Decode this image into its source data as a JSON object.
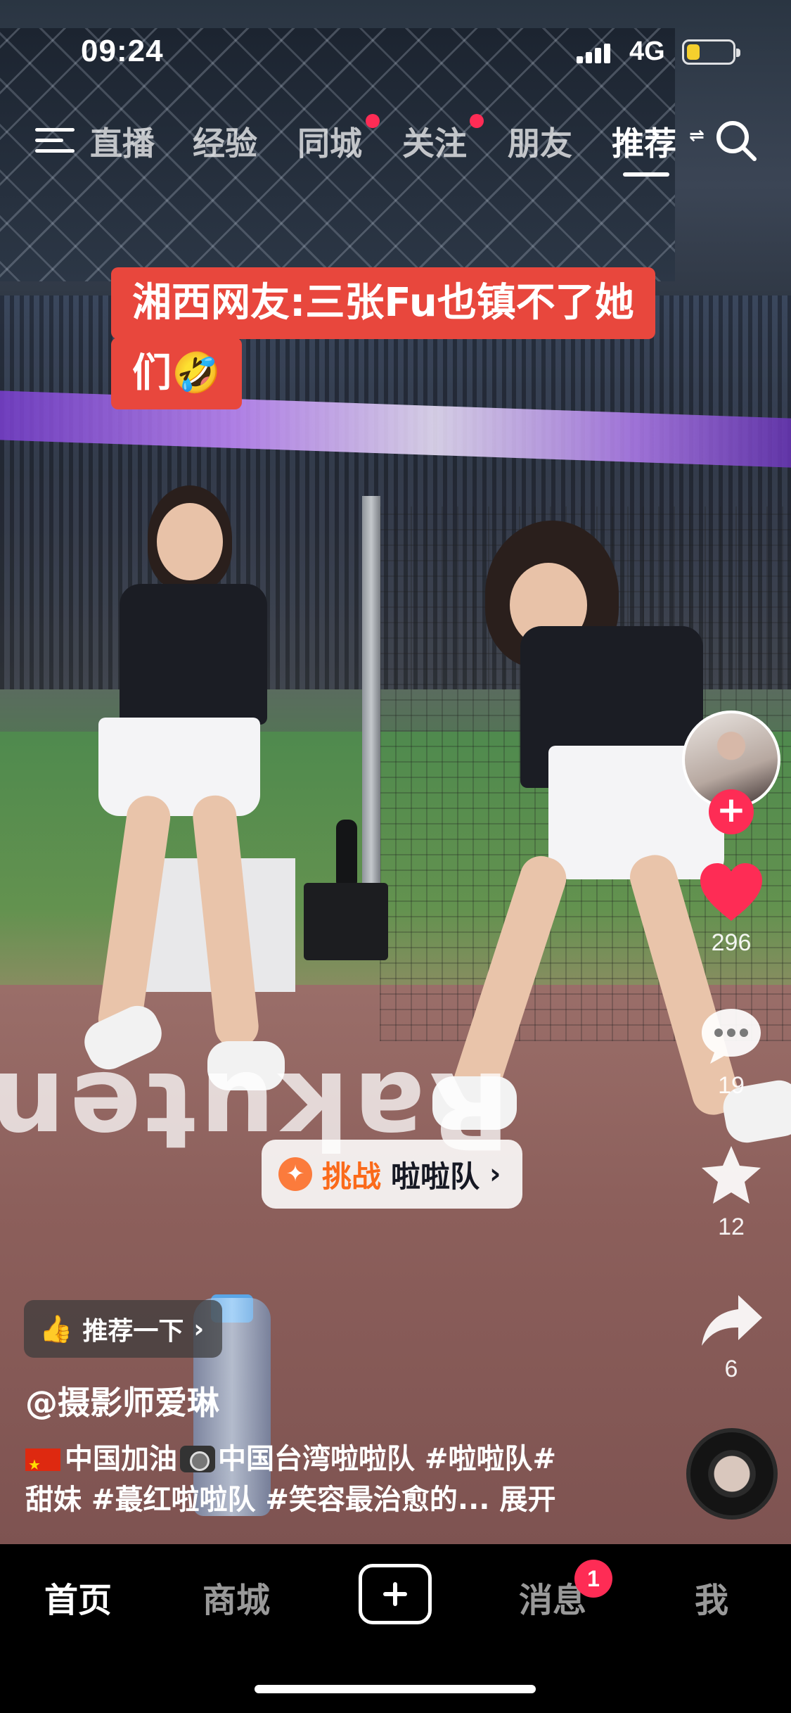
{
  "status_bar": {
    "time": "09:24",
    "network": "4G",
    "battery_level": 0.25
  },
  "top_nav": {
    "tabs": [
      {
        "label": "直播",
        "active": false,
        "has_dot": false
      },
      {
        "label": "经验",
        "active": false,
        "has_dot": false
      },
      {
        "label": "同城",
        "active": false,
        "has_dot": true
      },
      {
        "label": "关注",
        "active": false,
        "has_dot": true
      },
      {
        "label": "朋友",
        "active": false,
        "has_dot": false
      },
      {
        "label": "推荐",
        "active": true,
        "has_dot": false
      }
    ],
    "icons": {
      "menu": "hamburger-icon",
      "switch": "swap-icon",
      "search": "search-icon"
    }
  },
  "video": {
    "caption_line1": "湘西网友:三张Fu也镇不了她",
    "caption_line2": "们🤣"
  },
  "actions": {
    "follow_symbol": "+",
    "likes": "296",
    "comments": "19",
    "favorites": "12",
    "shares": "6"
  },
  "challenge": {
    "label": "挑战",
    "topic": "啦啦队",
    "chevron": "›"
  },
  "recommend": {
    "label": "推荐一下",
    "chevron": "›"
  },
  "author": "@摄影师爱琳",
  "description": {
    "line1_a": "中国加油",
    "line1_b": "中国台湾啦啦队 #啦啦队#",
    "line2": "甜妹 #蕞红啦啦队 #笑容最治愈的...",
    "expand": "展开"
  },
  "tab_bar": {
    "home": "首页",
    "mall": "商城",
    "messages": "消息",
    "messages_badge": "1",
    "me": "我"
  },
  "colors": {
    "accent_red": "#fe2c55",
    "caption_bg": "#e8473d",
    "challenge_orange": "#fb6a1a",
    "battery_yellow": "#f5cf2d"
  }
}
